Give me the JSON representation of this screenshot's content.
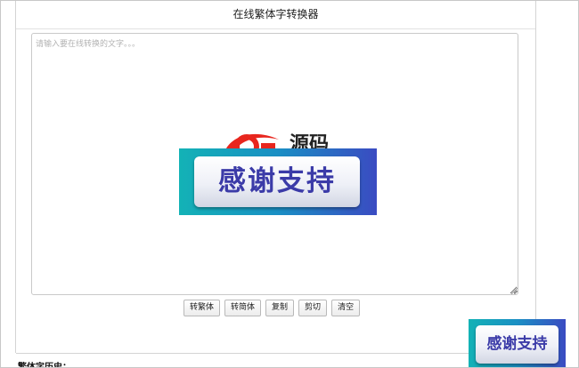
{
  "page": {
    "title": "在线繁体字转换器"
  },
  "editor": {
    "placeholder": "请输入要在线转换的文字。。。",
    "value": ""
  },
  "logo": {
    "text": "源码",
    "colors": {
      "swoosh": "#e8261e",
      "text": "#222222"
    }
  },
  "toolbar": {
    "to_traditional_label": "转繁体",
    "to_simplified_label": "转简体",
    "copy_label": "复制",
    "cut_label": "剪切",
    "clear_label": "清空"
  },
  "history": {
    "label": "繁体字历史："
  },
  "overlay_badges": {
    "large_text": "感谢支持",
    "small_text": "感谢支持",
    "colors": {
      "gradient_start": "#13b2b6",
      "gradient_end": "#3a4bc2",
      "text": "#3b3ba8"
    }
  },
  "icons": {
    "resize_grip": "resize-grip-icon"
  }
}
